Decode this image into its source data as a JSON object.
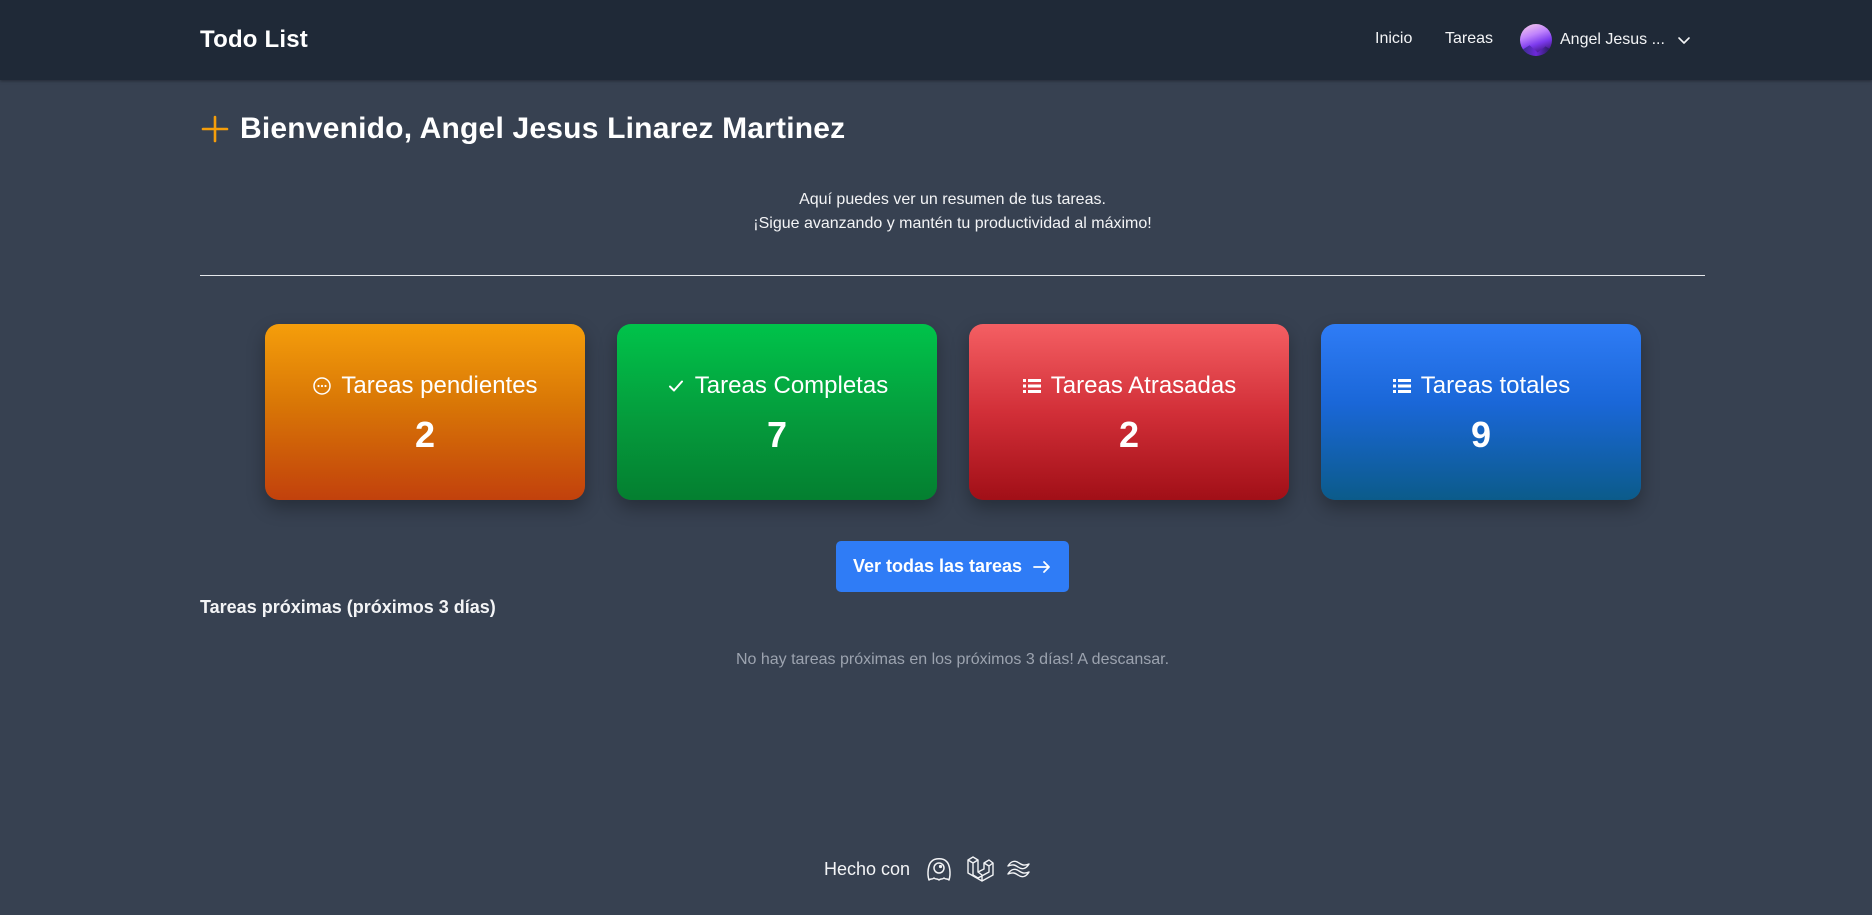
{
  "navbar": {
    "brand": "Todo List",
    "links": [
      "Inicio",
      "Tareas"
    ],
    "user_name": "Angel Jesus ..."
  },
  "welcome": {
    "title": "Bienvenido, Angel Jesus Linarez Martinez",
    "subtitle_line1": "Aquí puedes ver un resumen de tus tareas.",
    "subtitle_line2": "¡Sigue avanzando y mantén tu productividad al máximo!"
  },
  "cards": [
    {
      "label": "Tareas pendientes",
      "value": "2",
      "icon": "ellipsis-circle-icon",
      "color": "#f59e0b"
    },
    {
      "label": "Tareas Completas",
      "value": "7",
      "icon": "check-icon",
      "color": "#00c34a"
    },
    {
      "label": "Tareas Atrasadas",
      "value": "2",
      "icon": "list-icon",
      "color": "#f45f63"
    },
    {
      "label": "Tareas totales",
      "value": "9",
      "icon": "list-icon",
      "color": "#2f7cf6"
    }
  ],
  "actions": {
    "view_all_label": "Ver todas las tareas"
  },
  "upcoming": {
    "title": "Tareas próximas (próximos 3 días)",
    "empty_message": "No hay tareas próximas en los próximos 3 días! A descansar."
  },
  "footer": {
    "text": "Hecho con",
    "icons": [
      "livewire-icon",
      "laravel-icon",
      "tailwind-icon"
    ]
  },
  "colors": {
    "background": "#374151",
    "navbar": "#1f2937",
    "accent": "#f59e0b",
    "button": "#2f7cf6"
  }
}
